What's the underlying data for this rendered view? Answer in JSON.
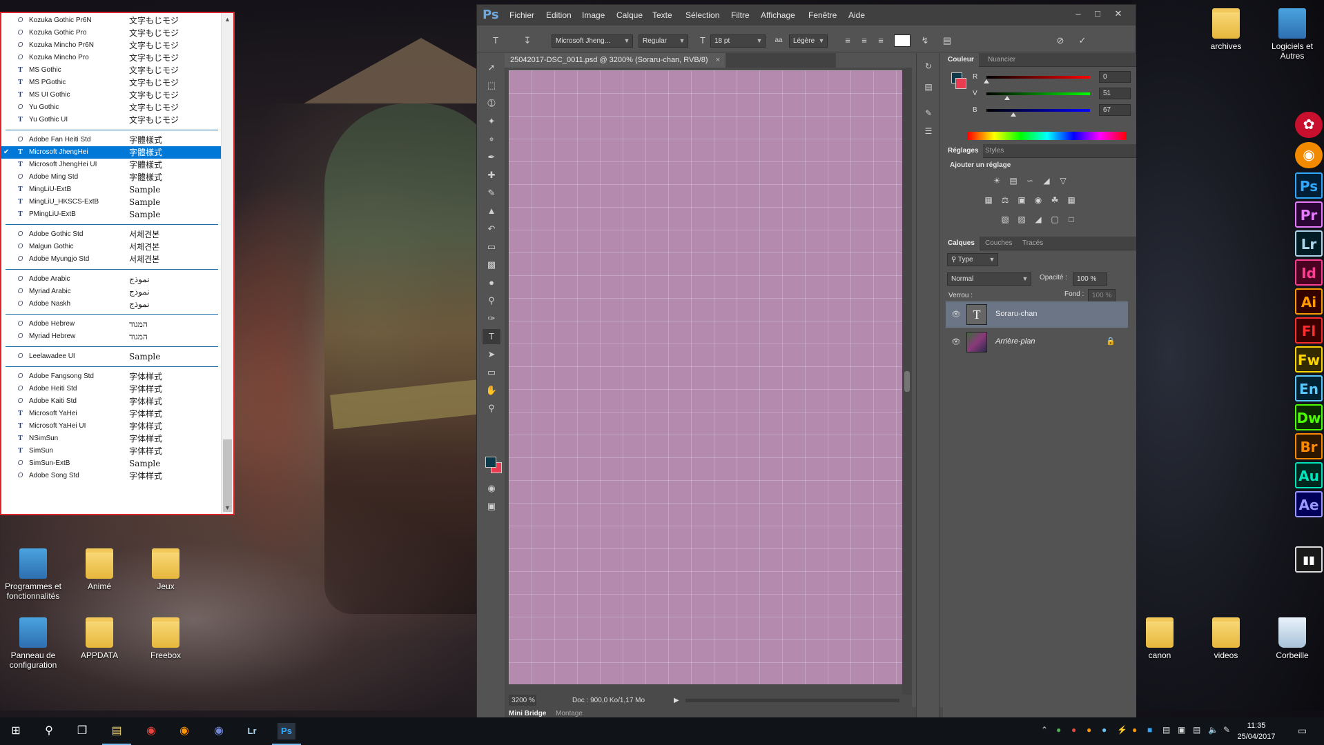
{
  "desktop": {
    "icons_left": [
      {
        "label": "Programmes et fonctionnalités",
        "kind": "sys"
      },
      {
        "label": "Animé",
        "kind": "folder"
      },
      {
        "label": "Jeux",
        "kind": "folder"
      },
      {
        "label": "Panneau de configuration",
        "kind": "sys"
      },
      {
        "label": "APPDATA",
        "kind": "folder"
      },
      {
        "label": "Freebox",
        "kind": "folder"
      }
    ],
    "icons_right": [
      {
        "label": "archives",
        "kind": "folder"
      },
      {
        "label": "Logiciels et Autres",
        "kind": "sys"
      },
      {
        "label": "canon",
        "kind": "folder"
      },
      {
        "label": "videos",
        "kind": "folder"
      },
      {
        "label": "Corbeille",
        "kind": "bin"
      }
    ]
  },
  "font_list": {
    "selected": "Microsoft JhengHei",
    "groups": [
      [
        {
          "name": "Kozuka Gothic Pr6N",
          "sample": "文字もじモジ",
          "type": "otf"
        },
        {
          "name": "Kozuka Gothic Pro",
          "sample": "文字もじモジ",
          "type": "otf"
        },
        {
          "name": "Kozuka Mincho Pr6N",
          "sample": "文字もじモジ",
          "type": "otf"
        },
        {
          "name": "Kozuka Mincho Pro",
          "sample": "文字もじモジ",
          "type": "otf"
        },
        {
          "name": "MS Gothic",
          "sample": "文字もじモジ",
          "type": "ttf"
        },
        {
          "name": "MS PGothic",
          "sample": "文字もじモジ",
          "type": "ttf"
        },
        {
          "name": "MS UI Gothic",
          "sample": "文字もじモジ",
          "type": "ttf"
        },
        {
          "name": "Yu Gothic",
          "sample": "文字もじモジ",
          "type": "otf"
        },
        {
          "name": "Yu Gothic UI",
          "sample": "文字もじモジ",
          "type": "ttf"
        }
      ],
      [
        {
          "name": "Adobe Fan Heiti Std",
          "sample": "字體樣式",
          "type": "otf"
        },
        {
          "name": "Microsoft JhengHei",
          "sample": "字體樣式",
          "type": "ttf"
        },
        {
          "name": "Microsoft JhengHei UI",
          "sample": "字體樣式",
          "type": "ttf"
        },
        {
          "name": "Adobe Ming Std",
          "sample": "字體樣式",
          "type": "otf"
        },
        {
          "name": "MingLiU-ExtB",
          "sample": "Sample",
          "type": "ttf"
        },
        {
          "name": "MingLiU_HKSCS-ExtB",
          "sample": "Sample",
          "type": "ttf"
        },
        {
          "name": "PMingLiU-ExtB",
          "sample": "Sample",
          "type": "ttf"
        }
      ],
      [
        {
          "name": "Adobe Gothic Std",
          "sample": "서체견본",
          "type": "otf"
        },
        {
          "name": "Malgun Gothic",
          "sample": "서체견본",
          "type": "otf"
        },
        {
          "name": "Adobe Myungjo Std",
          "sample": "서체견본",
          "type": "otf"
        }
      ],
      [
        {
          "name": "Adobe Arabic",
          "sample": "نموذج",
          "type": "otf"
        },
        {
          "name": "Myriad Arabic",
          "sample": "نموذج",
          "type": "otf"
        },
        {
          "name": "Adobe Naskh",
          "sample": "نموذج",
          "type": "otf"
        }
      ],
      [
        {
          "name": "Adobe Hebrew",
          "sample": "המגוד",
          "type": "otf"
        },
        {
          "name": "Myriad Hebrew",
          "sample": "המגוד",
          "type": "otf"
        }
      ],
      [
        {
          "name": "Leelawadee UI",
          "sample": "Sample",
          "type": "otf"
        }
      ],
      [
        {
          "name": "Adobe Fangsong Std",
          "sample": "字体样式",
          "type": "otf"
        },
        {
          "name": "Adobe Heiti Std",
          "sample": "字体样式",
          "type": "otf"
        },
        {
          "name": "Adobe Kaiti Std",
          "sample": "字体样式",
          "type": "otf"
        },
        {
          "name": "Microsoft YaHei",
          "sample": "字体样式",
          "type": "ttf"
        },
        {
          "name": "Microsoft YaHei UI",
          "sample": "字体样式",
          "type": "ttf"
        },
        {
          "name": "NSimSun",
          "sample": "字体样式",
          "type": "ttf"
        },
        {
          "name": "SimSun",
          "sample": "字体样式",
          "type": "ttf"
        },
        {
          "name": "SimSun-ExtB",
          "sample": "Sample",
          "type": "otf"
        },
        {
          "name": "Adobe Song Std",
          "sample": "字体样式",
          "type": "otf"
        }
      ]
    ]
  },
  "photoshop": {
    "logo": "Ps",
    "menu": [
      "Fichier",
      "Edition",
      "Image",
      "Calque",
      "Texte",
      "Sélection",
      "Filtre",
      "Affichage",
      "Fenêtre",
      "Aide"
    ],
    "options": {
      "font_family": "Microsoft Jheng...",
      "font_style": "Regular",
      "font_size": "18 pt",
      "antialias": "Légère",
      "antialias_icon": "aa"
    },
    "doc_tab": "25042017-DSC_0011.psd @ 3200% (Soraru-chan, RVB/8)",
    "status_zoom": "3200 %",
    "status_doc": "Doc : 900,0 Ko/1,17 Mo",
    "bottom_tabs": [
      "Mini Bridge",
      "Montage"
    ],
    "color_panel": {
      "tabs": [
        "Couleur",
        "Nuancier"
      ],
      "channels": [
        {
          "label": "R",
          "value": "0",
          "fraction": 0.0,
          "color_from": "#000000",
          "color_to": "#ff0000"
        },
        {
          "label": "V",
          "value": "51",
          "fraction": 0.2,
          "color_from": "#000000",
          "color_to": "#00ff00"
        },
        {
          "label": "B",
          "value": "67",
          "fraction": 0.26,
          "color_from": "#000000",
          "color_to": "#0000ff"
        }
      ],
      "foreground": "#0c3a4b",
      "background": "#ea3b50"
    },
    "adjustments": {
      "tabs": [
        "Réglages",
        "Styles"
      ],
      "title": "Ajouter un réglage"
    },
    "layers_panel": {
      "tabs": [
        "Calques",
        "Couches",
        "Tracés"
      ],
      "filter": "Type",
      "blend_mode": "Normal",
      "opacity_label": "Opacité :",
      "opacity": "100 %",
      "lock_label": "Verrou :",
      "fill_label": "Fond :",
      "fill": "100 %",
      "layers": [
        {
          "name": "Soraru-chan",
          "type": "text"
        },
        {
          "name": "Arrière-plan",
          "type": "image"
        }
      ]
    }
  },
  "dock": [
    {
      "label": "Ps",
      "color": "#31a8ff",
      "bg": "#001e36"
    },
    {
      "label": "Pr",
      "color": "#e77cff",
      "bg": "#2a0634"
    },
    {
      "label": "Lr",
      "color": "#add5ec",
      "bg": "#001d26"
    },
    {
      "label": "Id",
      "color": "#ff3d93",
      "bg": "#49021f"
    },
    {
      "label": "Ai",
      "color": "#ff9a00",
      "bg": "#330000"
    },
    {
      "label": "Fl",
      "color": "#ff2e2e",
      "bg": "#3a0000"
    },
    {
      "label": "Fw",
      "color": "#ffd500",
      "bg": "#332a00"
    },
    {
      "label": "En",
      "color": "#59c9ff",
      "bg": "#002233"
    },
    {
      "label": "Dw",
      "color": "#4cff00",
      "bg": "#0c2a00"
    },
    {
      "label": "Br",
      "color": "#ff8a00",
      "bg": "#2d1700"
    },
    {
      "label": "Au",
      "color": "#00e4bb",
      "bg": "#00271f"
    },
    {
      "label": "Ae",
      "color": "#9999ff",
      "bg": "#00005b"
    }
  ],
  "taskbar": {
    "time": "11:35",
    "date": "25/04/2017"
  }
}
